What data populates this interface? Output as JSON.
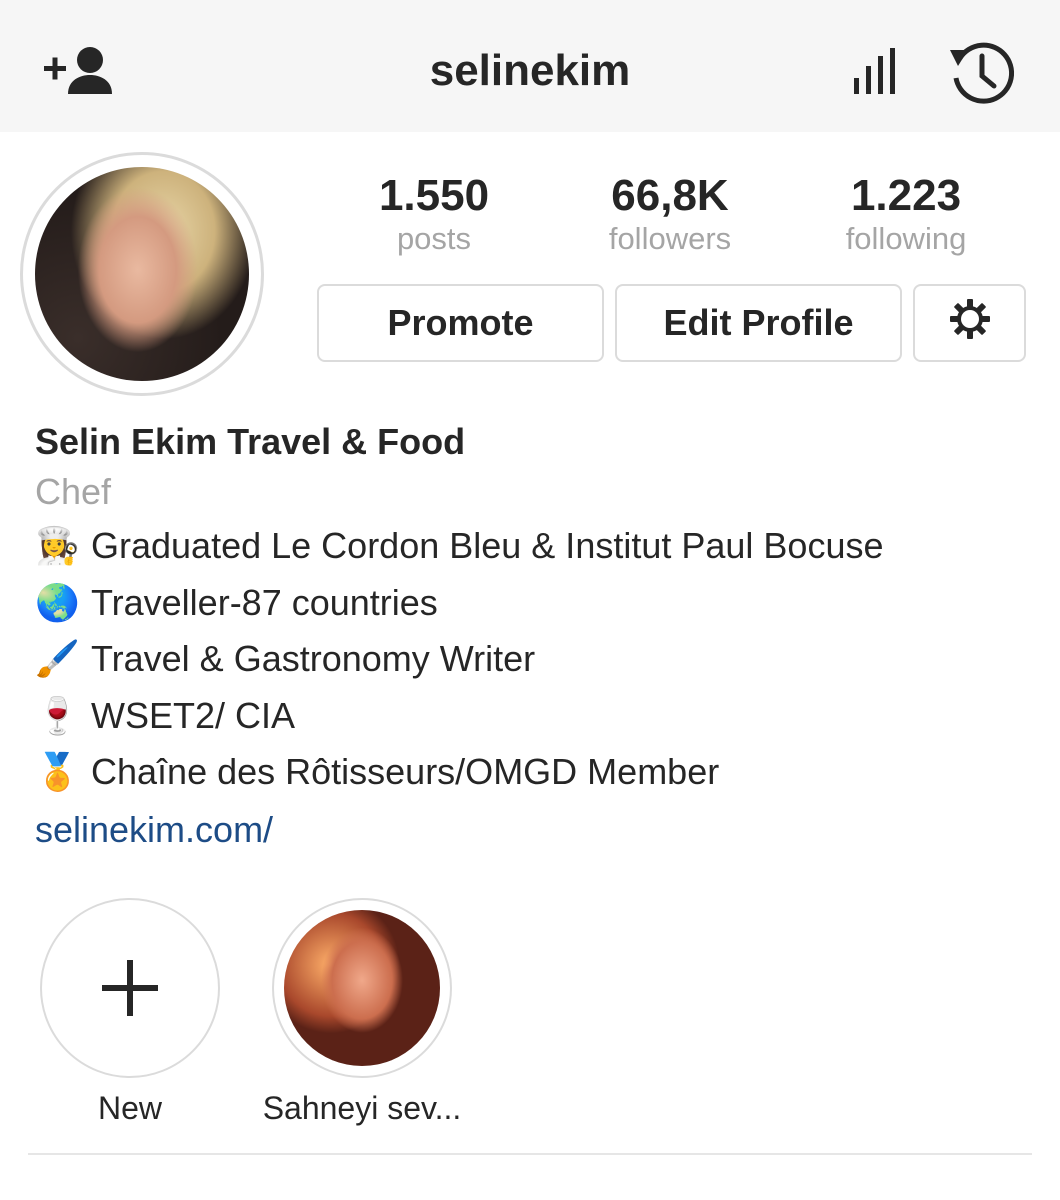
{
  "header": {
    "username": "selinekim",
    "icons": {
      "add_user": "add-user-icon",
      "insights": "bar-chart-icon",
      "archive": "history-icon"
    }
  },
  "profile": {
    "stats": {
      "posts": {
        "value": "1.550",
        "label": "posts"
      },
      "followers": {
        "value": "66,8K",
        "label": "followers"
      },
      "following": {
        "value": "1.223",
        "label": "following"
      }
    },
    "buttons": {
      "promote": "Promote",
      "edit_profile": "Edit Profile",
      "settings_icon": "gear-icon"
    }
  },
  "bio": {
    "name": "Selin Ekim Travel & Food",
    "category": "Chef",
    "lines": [
      {
        "emoji": "👩‍🍳",
        "text": "Graduated Le Cordon Bleu & Institut Paul Bocuse"
      },
      {
        "emoji": "🌏",
        "text": "Traveller-87 countries"
      },
      {
        "emoji": "🖌️",
        "text": "Travel & Gastronomy Writer"
      },
      {
        "emoji": "🍷",
        "text": "WSET2/ CIA"
      },
      {
        "emoji": "🏅",
        "text": "Chaîne des Rôtisseurs/OMGD Member"
      }
    ],
    "link": "selinekim.com/"
  },
  "highlights": [
    {
      "label": "New"
    },
    {
      "label": "Sahneyi sev..."
    }
  ],
  "colors": {
    "text": "#262626",
    "muted": "#a5a5a5",
    "border": "#dbdbdb",
    "link": "#1d4c86",
    "accent": "#3897f0",
    "topbar_bg": "#f6f6f6"
  }
}
